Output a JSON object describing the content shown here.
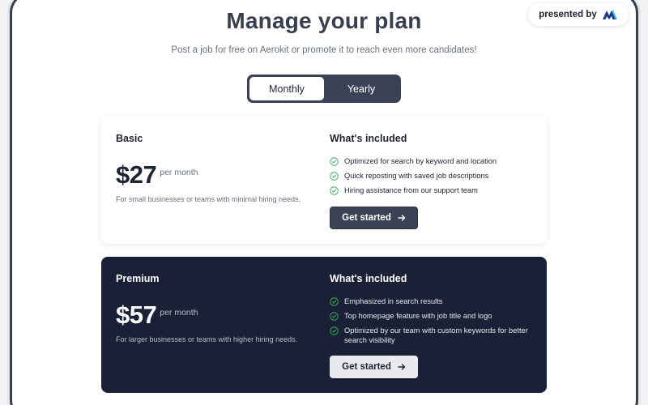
{
  "header": {
    "title": "Manage your plan",
    "subtitle": "Post a job for free on Aerokit or promote it to reach even more candidates!"
  },
  "billing_toggle": {
    "options": [
      "Monthly",
      "Yearly"
    ],
    "selected": "Monthly"
  },
  "badge": {
    "label": "presented by",
    "logo_icon": "brand-logo-icon"
  },
  "plans": [
    {
      "name": "Basic",
      "price": "$27",
      "period": "per month",
      "description": "For small businesses or teams with minimal hiring needs.",
      "included_title": "What's included",
      "features": [
        "Optimized for search by keyword and location",
        "Quick reposting with saved job descriptions",
        "Hiring assistance from our support team"
      ],
      "cta": "Get started"
    },
    {
      "name": "Premium",
      "price": "$57",
      "period": "per month",
      "description": "For larger businesses or teams with higher hiring needs.",
      "included_title": "What's included",
      "features": [
        "Emphasized in search results",
        "Top homepage feature with job title and logo",
        "Optimized by our team with custom keywords for better search visibility"
      ],
      "cta": "Get started"
    }
  ],
  "colors": {
    "accent_dark": "#3b4255",
    "premium_bg": "#1a2035",
    "check_green": "#3fae5a",
    "brand_blue": "#2b7bd6"
  }
}
